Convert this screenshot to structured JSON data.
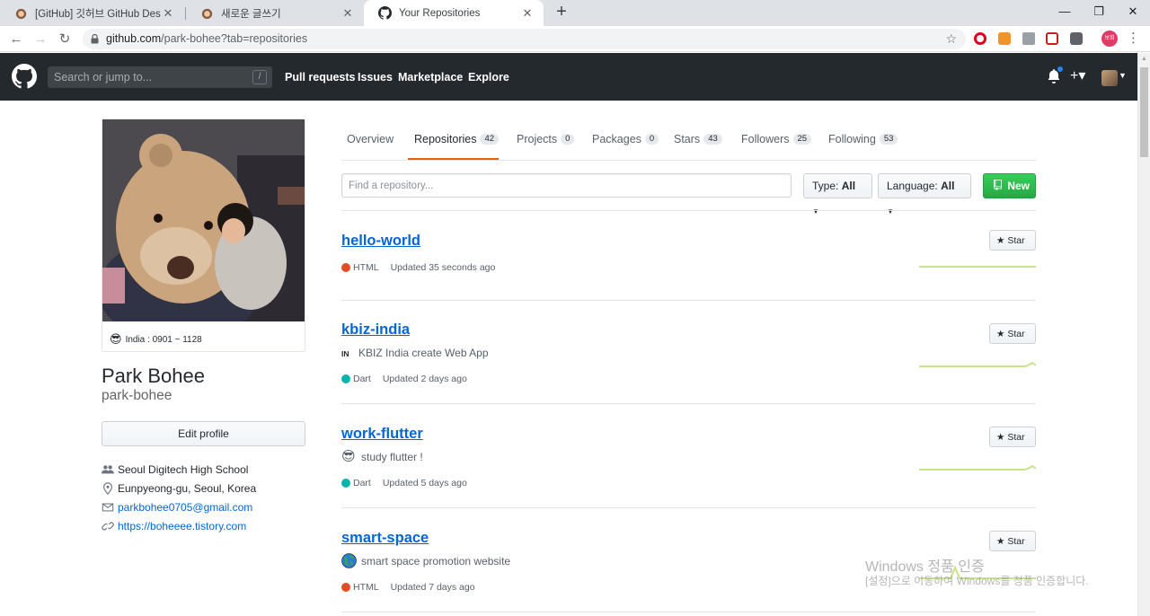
{
  "browser": {
    "tabs": [
      {
        "title": "[GitHub] 깃허브 GitHub Desktop"
      },
      {
        "title": "새로운 글쓰기"
      },
      {
        "title": "Your Repositories"
      }
    ],
    "url_host": "github.com",
    "url_path": "/park-bohee?tab=repositories",
    "avatar_text": "보희"
  },
  "header": {
    "search_placeholder": "Search or jump to...",
    "search_key": "/",
    "nav": [
      "Pull requests",
      "Issues",
      "Marketplace",
      "Explore"
    ]
  },
  "profile": {
    "status": "India : 0901 ~ 1128",
    "name": "Park Bohee",
    "login": "park-bohee",
    "edit_label": "Edit profile",
    "organization": "Seoul Digitech High School",
    "location": "Eunpyeong-gu, Seoul, Korea",
    "email": "parkbohee0705@gmail.com",
    "website": "https://boheeee.tistory.com"
  },
  "tabs": [
    {
      "label": "Overview",
      "count": null
    },
    {
      "label": "Repositories",
      "count": "42"
    },
    {
      "label": "Projects",
      "count": "0"
    },
    {
      "label": "Packages",
      "count": "0"
    },
    {
      "label": "Stars",
      "count": "43"
    },
    {
      "label": "Followers",
      "count": "25"
    },
    {
      "label": "Following",
      "count": "53"
    }
  ],
  "filters": {
    "find_placeholder": "Find a repository...",
    "type_label": "Type:",
    "type_value": "All",
    "language_label": "Language:",
    "language_value": "All",
    "new_label": "New"
  },
  "repos": [
    {
      "name": "hello-world",
      "description": "",
      "language": "HTML",
      "lang_color": "#e34c26",
      "updated": "Updated 35 seconds ago",
      "star_label": "Star"
    },
    {
      "name": "kbiz-india",
      "description": "KBIZ India create Web App",
      "desc_icon": "IN",
      "language": "Dart",
      "lang_color": "#00b4ab",
      "updated": "Updated 2 days ago",
      "star_label": "Star"
    },
    {
      "name": "work-flutter",
      "description": "study flutter !",
      "language": "Dart",
      "lang_color": "#00b4ab",
      "updated": "Updated 5 days ago",
      "star_label": "Star"
    },
    {
      "name": "smart-space",
      "description": "smart space promotion website",
      "language": "HTML",
      "lang_color": "#e34c26",
      "updated": "Updated 7 days ago",
      "star_label": "Star"
    }
  ],
  "watermark": {
    "line1": "Windows 정품 인증",
    "line2": "[설정]으로 이동하여 Windows를 정품 인증합니다."
  },
  "colors": {
    "github_header": "#24292e",
    "link": "#0366d6",
    "tab_underline": "#e36209",
    "new_button": "#28a745"
  }
}
